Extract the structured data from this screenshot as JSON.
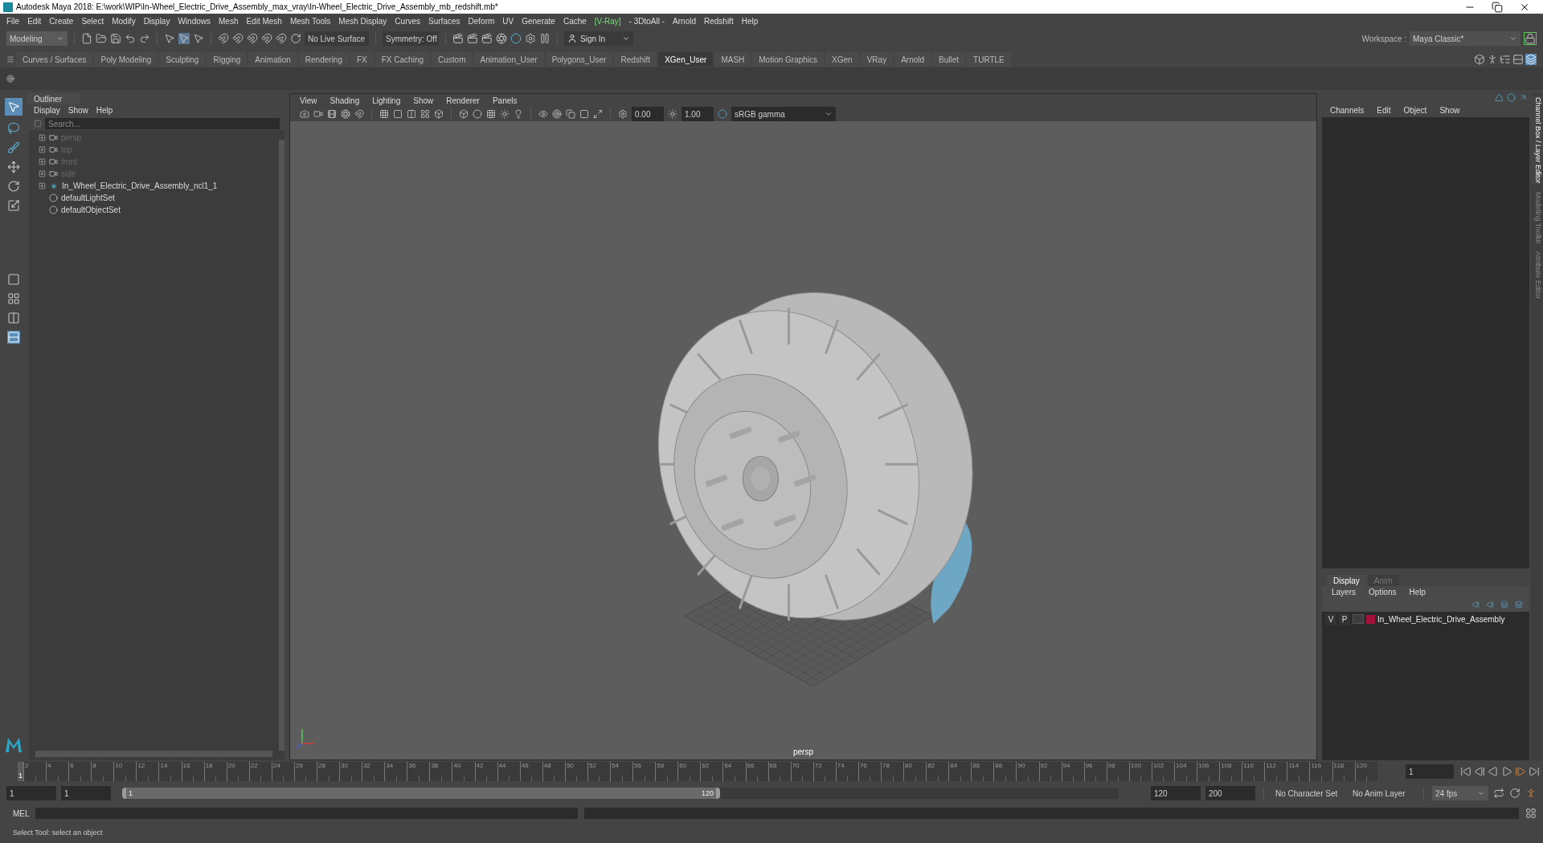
{
  "window": {
    "title": "Autodesk Maya 2018: E:\\work\\WIP\\In-Wheel_Electric_Drive_Assembly_max_vray\\In-Wheel_Electric_Drive_Assembly_mb_redshift.mb*"
  },
  "menu_bar": [
    {
      "label": "File",
      "highlighted": false
    },
    {
      "label": "Edit",
      "highlighted": false
    },
    {
      "label": "Create",
      "highlighted": false
    },
    {
      "label": "Select",
      "highlighted": false
    },
    {
      "label": "Modify",
      "highlighted": false
    },
    {
      "label": "Display",
      "highlighted": false
    },
    {
      "label": "Windows",
      "highlighted": false
    },
    {
      "label": "Mesh",
      "highlighted": false
    },
    {
      "label": "Edit Mesh",
      "highlighted": false
    },
    {
      "label": "Mesh Tools",
      "highlighted": false
    },
    {
      "label": "Mesh Display",
      "highlighted": false
    },
    {
      "label": "Curves",
      "highlighted": false
    },
    {
      "label": "Surfaces",
      "highlighted": false
    },
    {
      "label": "Deform",
      "highlighted": false
    },
    {
      "label": "UV",
      "highlighted": false
    },
    {
      "label": "Generate",
      "highlighted": false
    },
    {
      "label": "Cache",
      "highlighted": false
    },
    {
      "label": "[V-Ray]",
      "highlighted": true
    },
    {
      "label": "- 3DtoAll -",
      "highlighted": false
    },
    {
      "label": "Arnold",
      "highlighted": false
    },
    {
      "label": "Redshift",
      "highlighted": false
    },
    {
      "label": "Help",
      "highlighted": false
    }
  ],
  "status_line": {
    "mode": "Modeling",
    "live_surface": "No Live Surface",
    "symmetry": "Symmetry: Off",
    "sign_in": "Sign In",
    "workspace_label": "Workspace :",
    "workspace": "Maya Classic*"
  },
  "shelf_tabs": [
    {
      "label": "Curves / Surfaces",
      "selected": false
    },
    {
      "label": "Poly Modeling",
      "selected": false
    },
    {
      "label": "Sculpting",
      "selected": false
    },
    {
      "label": "Rigging",
      "selected": false
    },
    {
      "label": "Animation",
      "selected": false
    },
    {
      "label": "Rendering",
      "selected": false
    },
    {
      "label": "FX",
      "selected": false
    },
    {
      "label": "FX Caching",
      "selected": false
    },
    {
      "label": "Custom",
      "selected": false
    },
    {
      "label": "Animation_User",
      "selected": false
    },
    {
      "label": "Polygons_User",
      "selected": false
    },
    {
      "label": "Redshift",
      "selected": false
    },
    {
      "label": "XGen_User",
      "selected": true
    },
    {
      "label": "MASH",
      "selected": false
    },
    {
      "label": "Motion Graphics",
      "selected": false
    },
    {
      "label": "XGen",
      "selected": false
    },
    {
      "label": "VRay",
      "selected": false
    },
    {
      "label": "Arnold",
      "selected": false
    },
    {
      "label": "Bullet",
      "selected": false
    },
    {
      "label": "TURTLE",
      "selected": false
    }
  ],
  "outliner": {
    "title": "Outliner",
    "menu": [
      "Display",
      "Show",
      "Help"
    ],
    "search_placeholder": "Search...",
    "items": [
      {
        "label": "persp",
        "kind": "camera",
        "expandable": true,
        "dimmed": true
      },
      {
        "label": "top",
        "kind": "camera",
        "expandable": true,
        "dimmed": true
      },
      {
        "label": "front",
        "kind": "camera",
        "expandable": true,
        "dimmed": true
      },
      {
        "label": "side",
        "kind": "camera",
        "expandable": true,
        "dimmed": true
      },
      {
        "label": "In_Wheel_Electric_Drive_Assembly_ncl1_1",
        "kind": "transform",
        "expandable": true,
        "dimmed": false
      },
      {
        "label": "defaultLightSet",
        "kind": "set",
        "expandable": false,
        "dimmed": false
      },
      {
        "label": "defaultObjectSet",
        "kind": "set",
        "expandable": false,
        "dimmed": false
      }
    ]
  },
  "viewport": {
    "menu": [
      "View",
      "Shading",
      "Lighting",
      "Show",
      "Renderer",
      "Panels"
    ],
    "exposure": "0.00",
    "gamma": "1.00",
    "color_space": "sRGB gamma",
    "camera_label": "persp"
  },
  "channel_box": {
    "menu": [
      "Channels",
      "Edit",
      "Object",
      "Show"
    ]
  },
  "side_tabs": [
    {
      "label": "Channel Box / Layer Editor",
      "selected": true
    },
    {
      "label": "Modeling Toolkit",
      "selected": false
    },
    {
      "label": "Attribute Editor",
      "selected": false
    }
  ],
  "layer_editor": {
    "tabs": [
      {
        "label": "Display",
        "selected": true
      },
      {
        "label": "Anim",
        "selected": false
      }
    ],
    "menu": [
      "Layers",
      "Options",
      "Help"
    ],
    "layers": [
      {
        "visible": "V",
        "playback": "P",
        "name": "In_Wheel_Electric_Drive_Assembly",
        "color": "#a3123a"
      }
    ]
  },
  "time_slider": {
    "level": 0,
    "current_frame": "1",
    "frame_field": "1",
    "ticks": [
      "2",
      "4",
      "6",
      "8",
      "10",
      "12",
      "14",
      "16",
      "18",
      "20",
      "22",
      "24",
      "26",
      "28",
      "30",
      "32",
      "34",
      "36",
      "38",
      "40",
      "42",
      "44",
      "46",
      "48",
      "50",
      "52",
      "54",
      "56",
      "58",
      "60",
      "62",
      "64",
      "66",
      "68",
      "70",
      "72",
      "74",
      "76",
      "78",
      "80",
      "82",
      "84",
      "86",
      "88",
      "90",
      "92",
      "94",
      "96",
      "98",
      "100",
      "102",
      "104",
      "106",
      "108",
      "110",
      "112",
      "114",
      "116",
      "118",
      "120"
    ]
  },
  "range_slider": {
    "level": 0.6,
    "start": "1",
    "playback_start": "1",
    "range_start": "1",
    "range_end": "120",
    "playback_end": "120",
    "end": "200",
    "character_set": "No Character Set",
    "anim_layer": "No Anim Layer",
    "fps": "24 fps"
  },
  "command_line": {
    "label": "MEL"
  },
  "help_line": "Select Tool: select an object"
}
